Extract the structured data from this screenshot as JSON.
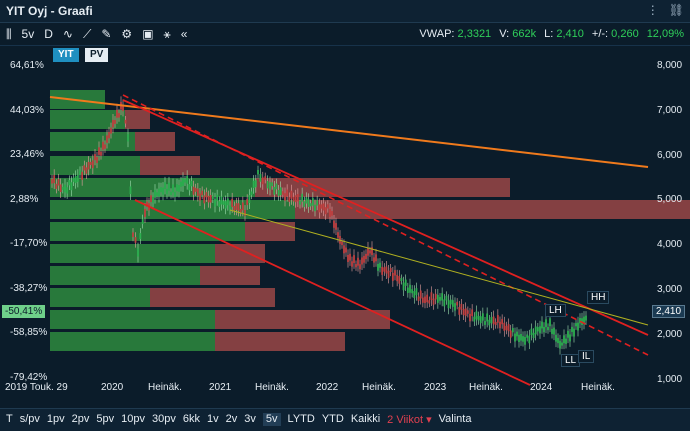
{
  "window": {
    "title": "YIT Oyj - Graafi"
  },
  "toolbar": {
    "period": "5v",
    "interval": "D",
    "stats": [
      {
        "label": "VWAP:",
        "value": "2,3321"
      },
      {
        "label": "V:",
        "value": "662k"
      },
      {
        "label": "L:",
        "value": "2,410"
      },
      {
        "label": "+/-:",
        "value": "0,260"
      },
      {
        "label": "",
        "value": "12,09%"
      }
    ]
  },
  "legend": {
    "symbol": "YIT",
    "pv": "PV"
  },
  "left_axis": [
    "64,61%",
    "44,03%",
    "23,46%",
    "2,88%",
    "-17,70%",
    "-38,27%",
    "-58,85%",
    "-79,42%"
  ],
  "left_highlight": "-50,41%",
  "right_axis": [
    "8,000",
    "7,000",
    "6,000",
    "5,000",
    "4,000",
    "3,000",
    "2,000",
    "1,000"
  ],
  "right_highlight": "2,410",
  "x_axis": [
    "2019 Touk. 29",
    "2020",
    "Heinäk.",
    "2021",
    "Heinäk.",
    "2022",
    "Heinäk.",
    "2023",
    "Heinäk.",
    "2024",
    "Heinäk."
  ],
  "annotations": {
    "lh": "LH",
    "hh": "HH",
    "ll": "LL",
    "il": "IL"
  },
  "bottom": {
    "items": [
      "T",
      "s/pv",
      "1pv",
      "2pv",
      "5pv",
      "10pv",
      "30pv",
      "6kk",
      "1v",
      "2v",
      "3v",
      "5v",
      "LYTD",
      "YTD",
      "Kaikki",
      "2 Viikot",
      "Valinta"
    ],
    "active": "5v"
  },
  "colors": {
    "up": "#2db050",
    "down": "#c04040",
    "orange": "#f07a1c",
    "red": "#e02020"
  }
}
